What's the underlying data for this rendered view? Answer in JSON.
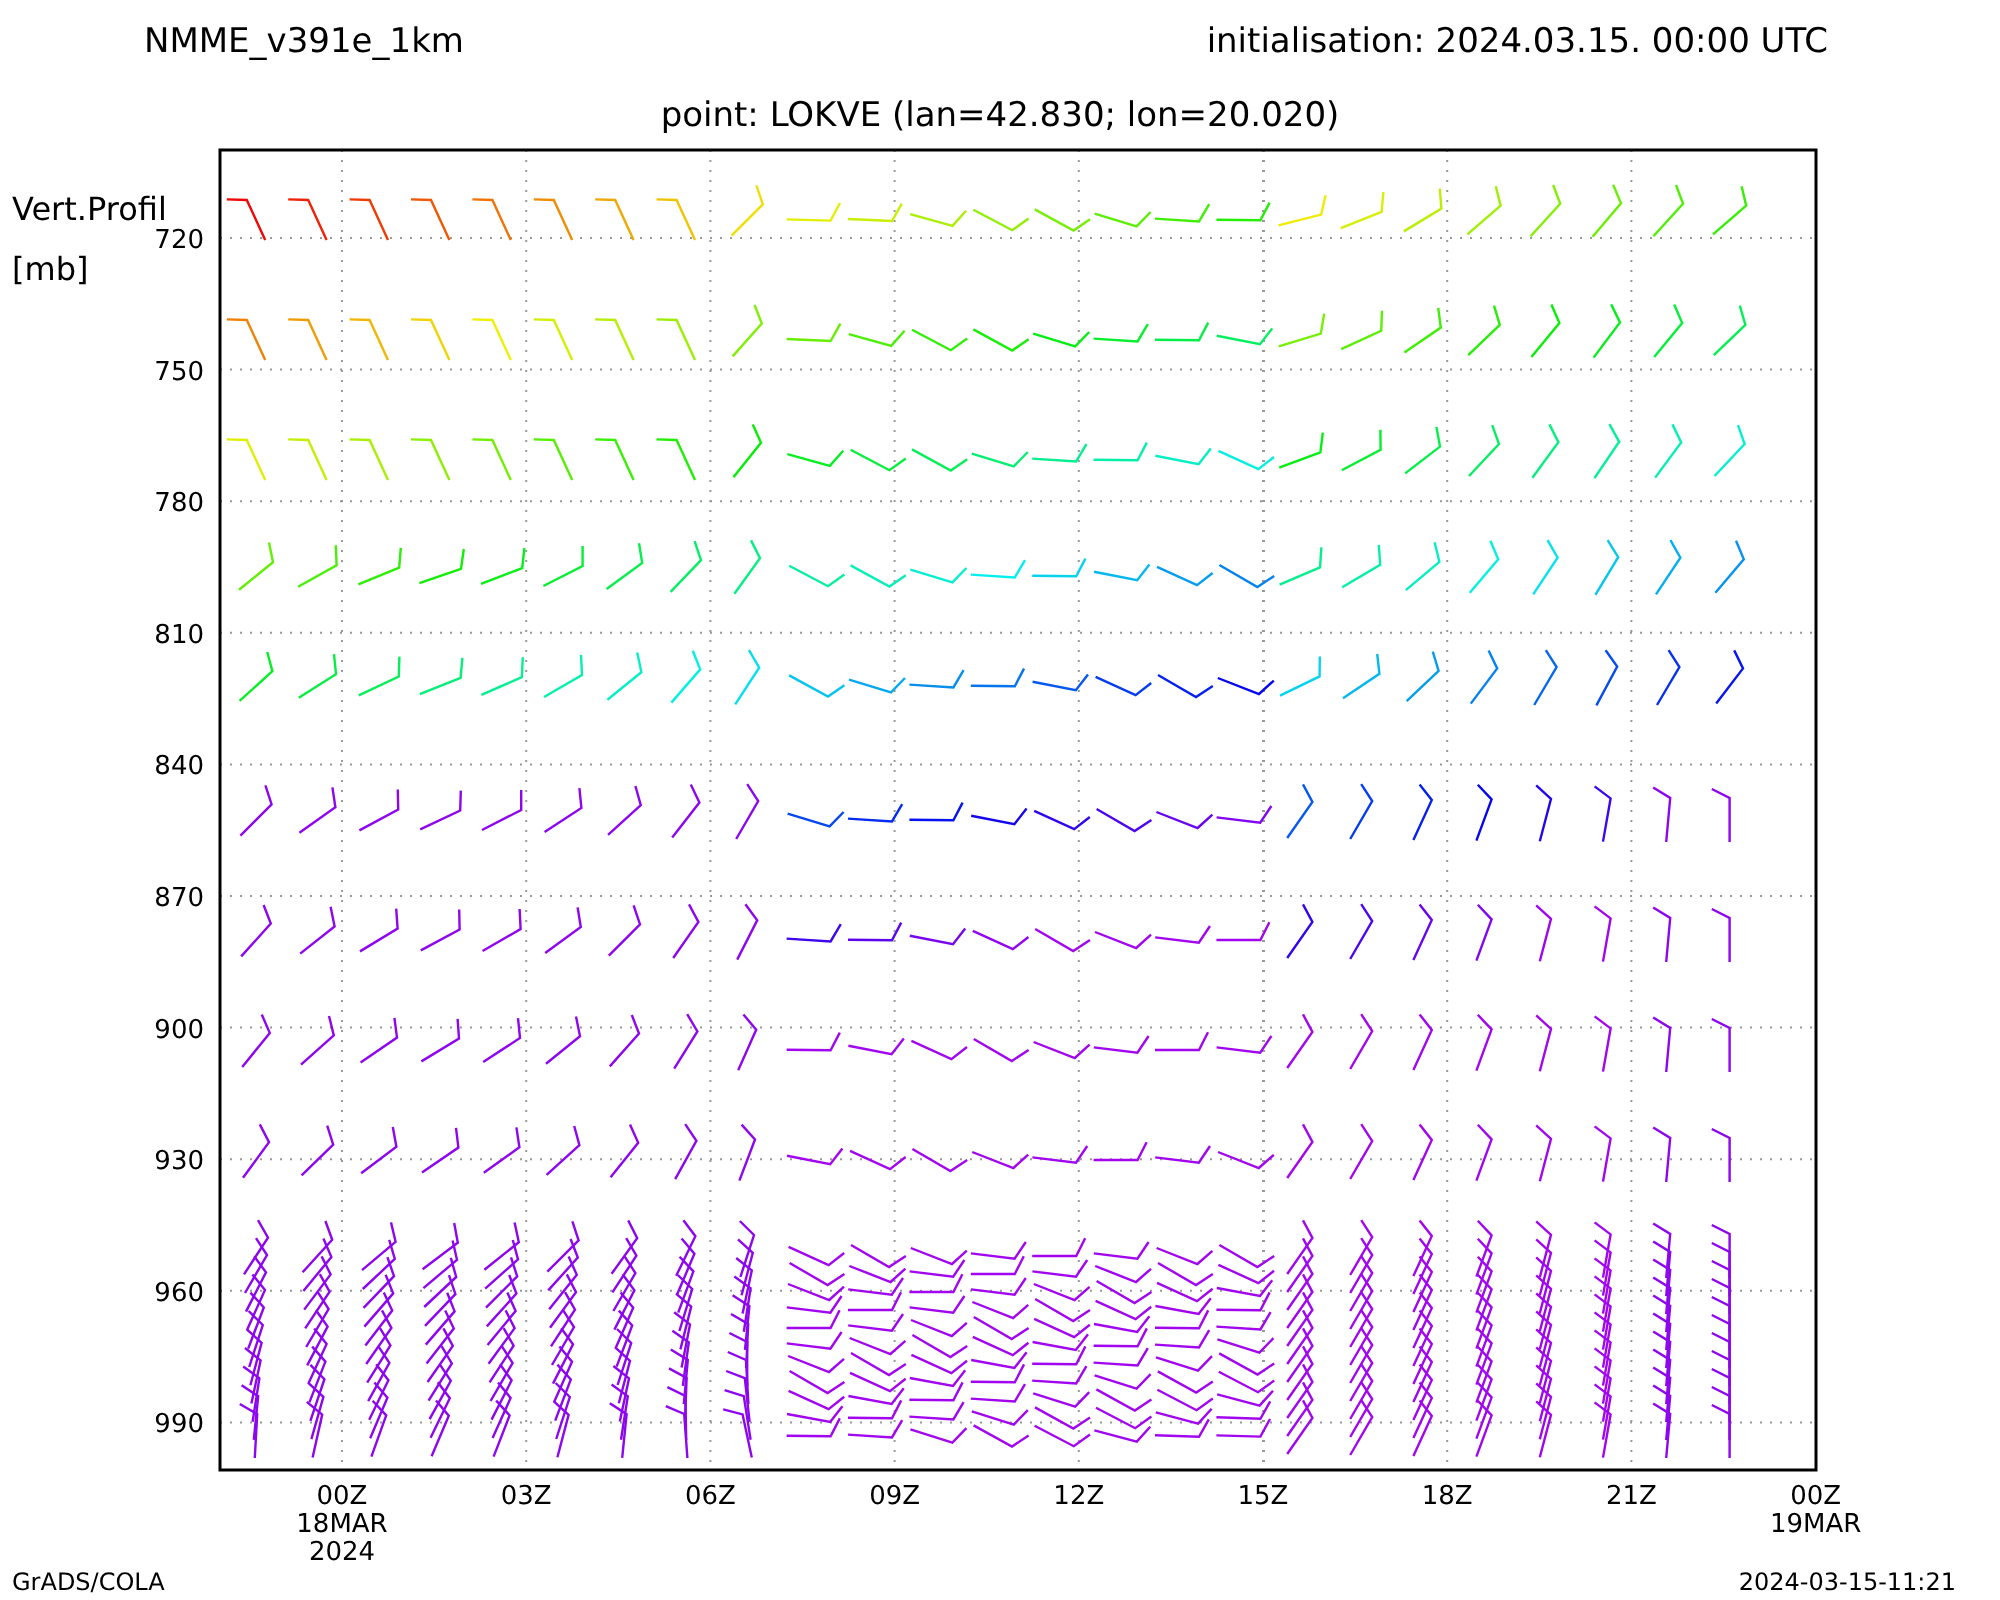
{
  "header": {
    "model": "NMME_v391e_1km",
    "initialisation": "initialisation: 2024.03.15. 00:00 UTC"
  },
  "chart": {
    "title": "point: LOKVE (lan=42.830; lon=20.020)",
    "ylabel": [
      "Vert.Profil",
      "[mb]"
    ],
    "yticks": [
      "720",
      "750",
      "780",
      "810",
      "840",
      "870",
      "900",
      "930",
      "960",
      "990"
    ],
    "xticks": [
      {
        "label": "00Z",
        "sub": [
          "18MAR",
          "2024"
        ]
      },
      {
        "label": "03Z"
      },
      {
        "label": "06Z"
      },
      {
        "label": "09Z"
      },
      {
        "label": "12Z"
      },
      {
        "label": "15Z"
      },
      {
        "label": "18Z"
      },
      {
        "label": "21Z"
      },
      {
        "label": "00Z",
        "sub": [
          "19MAR"
        ]
      }
    ]
  },
  "footer": {
    "left": "GrADS/COLA",
    "right": "2024-03-15-11:21"
  }
}
